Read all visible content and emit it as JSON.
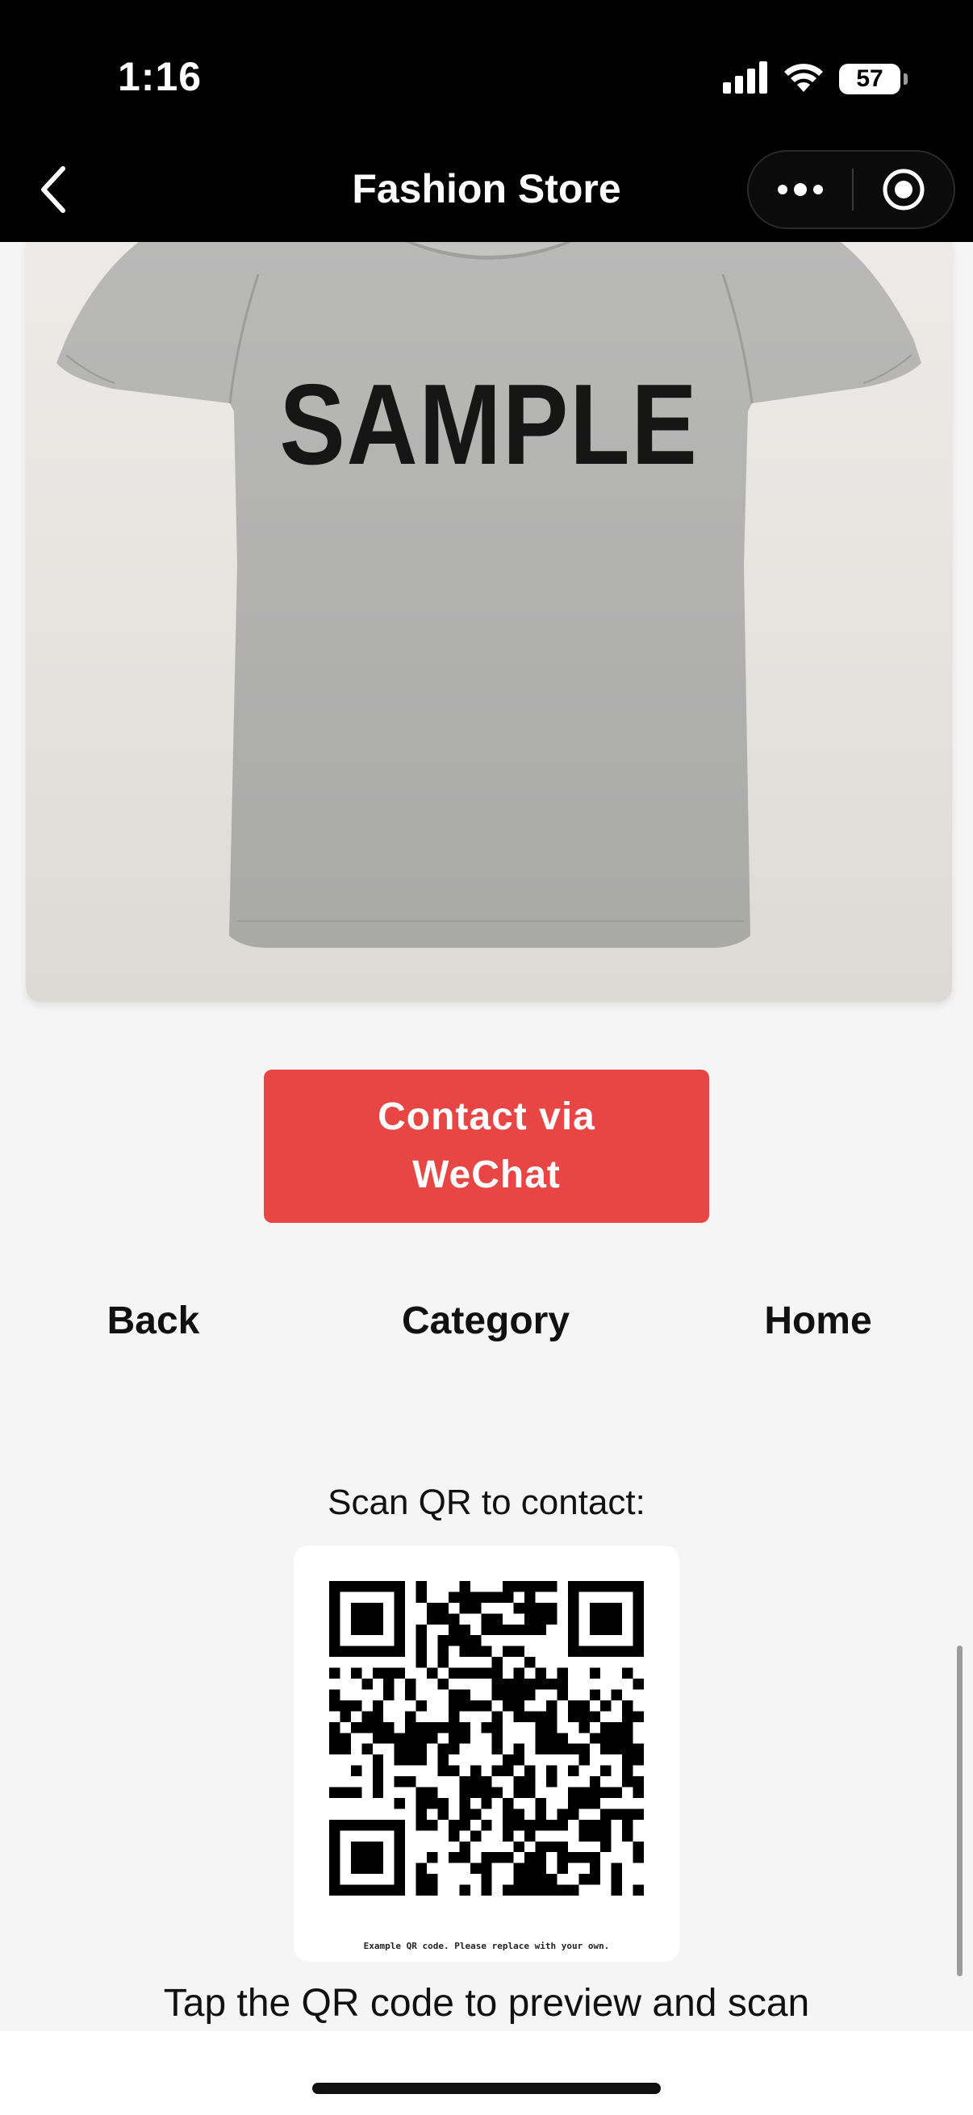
{
  "status_bar": {
    "time": "1:16",
    "battery": "57",
    "signal_icon": "cellular-signal-icon",
    "wifi_icon": "wifi-icon"
  },
  "nav": {
    "title": "Fashion Store",
    "back_icon": "chevron-left-icon",
    "more_icon": "more-dots-icon",
    "close_icon": "target-close-icon"
  },
  "product": {
    "image_text": "SAMPLE",
    "shirt_color": "#b0b0b0"
  },
  "contact_button": {
    "label": "Contact via\nWeChat",
    "color": "#e84545"
  },
  "footer_nav": {
    "back": "Back",
    "category": "Category",
    "home": "Home"
  },
  "qr": {
    "caption": "Scan QR to contact:",
    "note": "Example QR code. Please replace with your own.",
    "hint": "Tap the QR code to preview and scan"
  }
}
